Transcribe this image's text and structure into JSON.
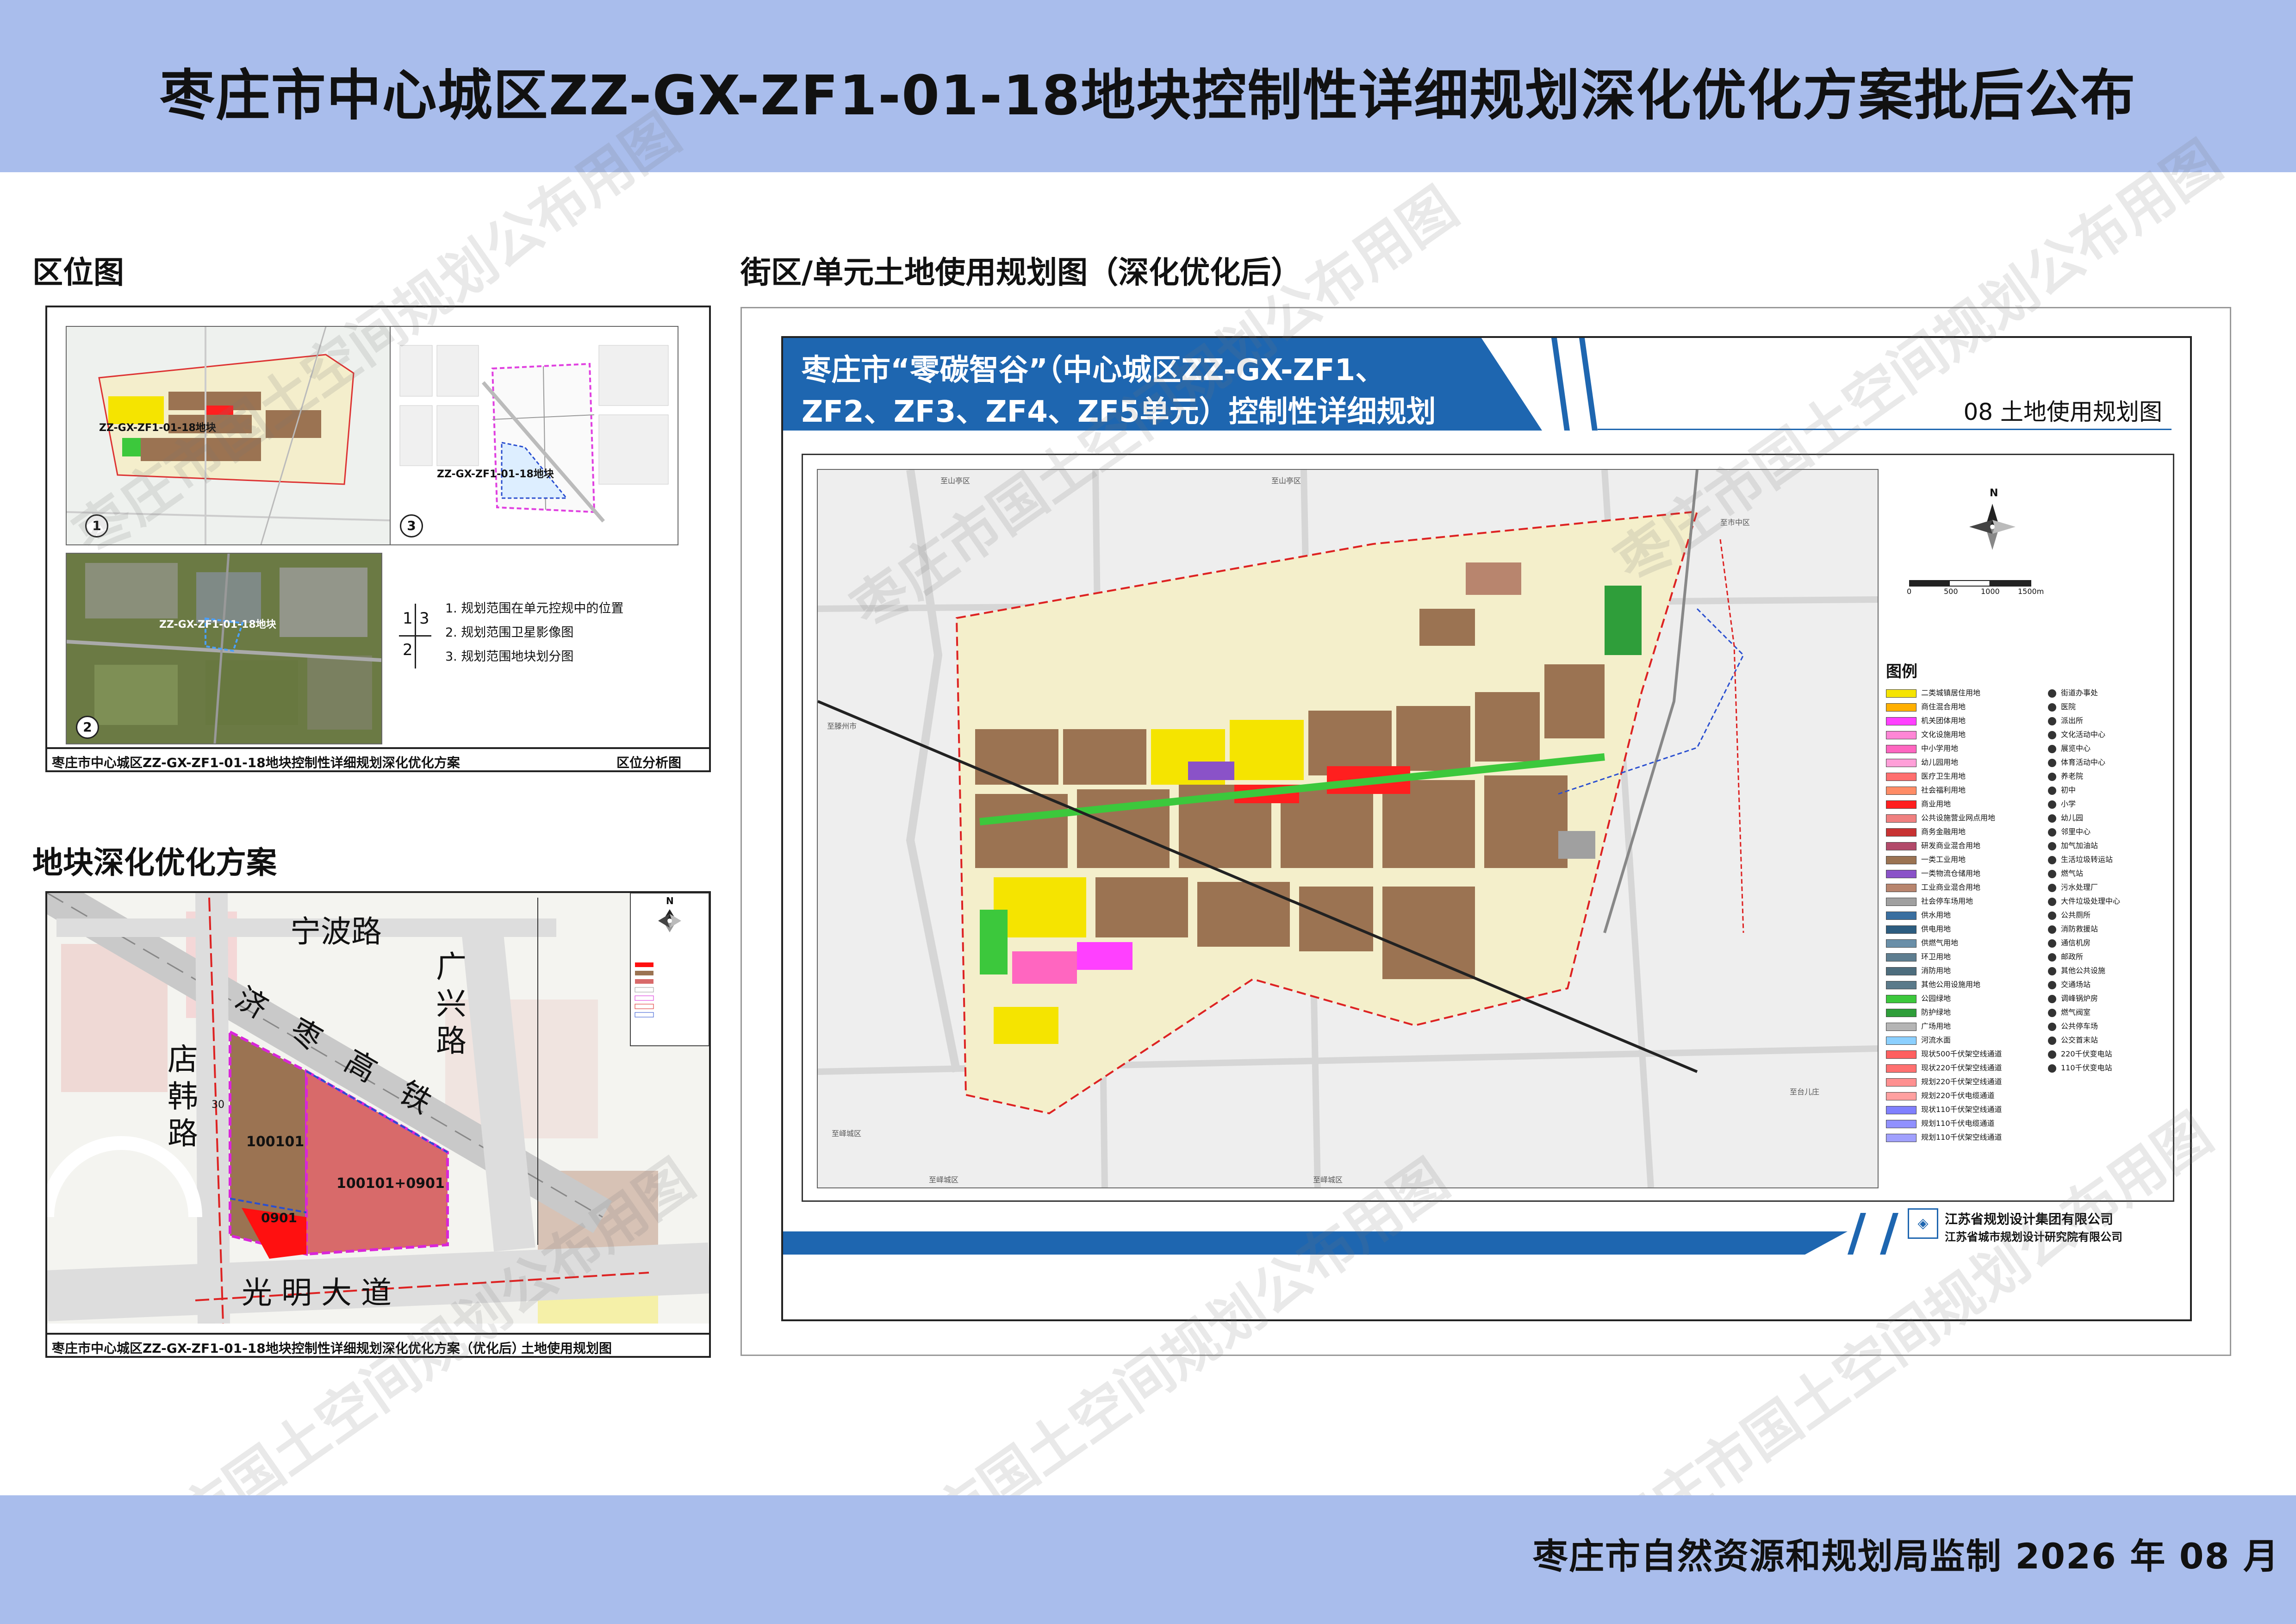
{
  "title": "枣庄市中心城区ZZ-GX-ZF1-01-18地块控制性详细规划深化优化方案批后公布",
  "sections": {
    "location": "区位图",
    "landuse": "街区/单元土地使用规划图（深化优化后）",
    "plot": "地块深化优化方案"
  },
  "location_panel": {
    "map1_label": "ZZ-GX-ZF1-01-18地块",
    "map2_label": "ZZ-GX-ZF1-01-18地块",
    "map3_label": "ZZ-GX-ZF1-01-18地块",
    "num1": "1",
    "num2": "2",
    "num3": "3",
    "key_tl": "1",
    "key_tr": "3",
    "key_bl": "2",
    "notes": [
      "1. 规划范围在单元控规中的位置",
      "2. 规划范围卫星影像图",
      "3. 规划范围地块划分图"
    ],
    "caption_left": "枣庄市中心城区ZZ-GX-ZF1-01-18地块控制性详细规划深化优化方案",
    "caption_right": "区位分析图"
  },
  "plot_panel": {
    "roads": {
      "top": "宁波路",
      "rail": "济枣高铁",
      "right": "广兴路",
      "left": "店韩路",
      "bottom": "光明大道"
    },
    "parcels": [
      "100101",
      "100101+0901",
      "0901"
    ],
    "dim": "30",
    "north": "N",
    "caption_left": "枣庄市中心城区ZZ-GX-ZF1-01-18地块控制性详细规划深化优化方案（优化后）",
    "caption_right": "土地使用规划图"
  },
  "big_map": {
    "title_line1": "枣庄市“零碳智谷”（中心城区ZZ-GX-ZF1、",
    "title_line2": "ZF2、ZF3、ZF4、ZF5单元）控制性详细规划",
    "subtitle": "08 土地使用规划图",
    "north": "N",
    "scale": [
      "0",
      "500",
      "1000",
      "1500m"
    ],
    "legend_title": "图例",
    "legend_left": [
      {
        "label": "二类城镇居住用地",
        "color": "#f5e400"
      },
      {
        "label": "商住混合用地",
        "color": "#ffb000"
      },
      {
        "label": "机关团体用地",
        "color": "#ff40ff"
      },
      {
        "label": "文化设施用地",
        "color": "#ff86d6"
      },
      {
        "label": "中小学用地",
        "color": "#ff66c0"
      },
      {
        "label": "幼儿园用地",
        "color": "#ff9fd8"
      },
      {
        "label": "医疗卫生用地",
        "color": "#ff6f6f"
      },
      {
        "label": "社会福利用地",
        "color": "#ff8c66"
      },
      {
        "label": "商业用地",
        "color": "#ff1f1f"
      },
      {
        "label": "公共设施营业网点用地",
        "color": "#f08080"
      },
      {
        "label": "商务金融用地",
        "color": "#c83232"
      },
      {
        "label": "研发商业混合用地",
        "color": "#b24a6a"
      },
      {
        "label": "一类工业用地",
        "color": "#9b7352"
      },
      {
        "label": "一类物流仓储用地",
        "color": "#8a52c8"
      },
      {
        "label": "工业商业混合用地",
        "color": "#b8856e"
      },
      {
        "label": "社会停车场用地",
        "color": "#a0a0a0"
      },
      {
        "label": "供水用地",
        "color": "#3a6fa0"
      },
      {
        "label": "供电用地",
        "color": "#2d5d80"
      },
      {
        "label": "供燃气用地",
        "color": "#6a8fa8"
      },
      {
        "label": "环卫用地",
        "color": "#5e7e90"
      },
      {
        "label": "消防用地",
        "color": "#4d6d7d"
      },
      {
        "label": "其他公用设施用地",
        "color": "#5a7a8a"
      },
      {
        "label": "公园绿地",
        "color": "#3cc83c"
      },
      {
        "label": "防护绿地",
        "color": "#2f9e3a"
      },
      {
        "label": "广场用地",
        "color": "#b5b5b5"
      },
      {
        "label": "河流水面",
        "color": "#8cd0ff"
      },
      {
        "label": "现状500千伏架空线通道",
        "color": "#ff6060"
      },
      {
        "label": "现状220千伏架空线通道",
        "color": "#ff7070"
      },
      {
        "label": "规划220千伏架空线通道",
        "color": "#ff9090"
      },
      {
        "label": "规划220千伏电缆通道",
        "color": "#ffa0a0"
      },
      {
        "label": "现状110千伏架空线通道",
        "color": "#8080ff"
      },
      {
        "label": "规划110千伏电缆通道",
        "color": "#9090ff"
      },
      {
        "label": "规划110千伏架空线通道",
        "color": "#a0a0ff"
      }
    ],
    "legend_right": [
      "街道办事处",
      "医院",
      "派出所",
      "文化活动中心",
      "展览中心",
      "体育活动中心",
      "养老院",
      "初中",
      "小学",
      "幼儿园",
      "邻里中心",
      "加气加油站",
      "生活垃圾转运站",
      "燃气站",
      "污水处理厂",
      "大件垃圾处理中心",
      "公共厕所",
      "消防救援站",
      "通信机房",
      "邮政所",
      "其他公共设施",
      "交通场站",
      "调峰锅炉房",
      "燃气阀室",
      "公共停车场",
      "公交首末站",
      "220千伏变电站",
      "110千伏变电站"
    ],
    "company1": "江苏省规划设计集团有限公司",
    "company2": "江苏省城市规划设计研究院有限公司",
    "edge_labels": {
      "top1": "至山亭区",
      "top2": "至山亭区",
      "right1": "至市中区",
      "right2": "至台儿庄",
      "bottom1": "至峄城区",
      "bottom2": "至峄城区",
      "left1": "至滕州市",
      "left2": "至峄城区"
    }
  },
  "watermark": "枣庄市国土空间规划公布用图",
  "footer": "枣庄市自然资源和规划局监制 2026 年 08 月"
}
